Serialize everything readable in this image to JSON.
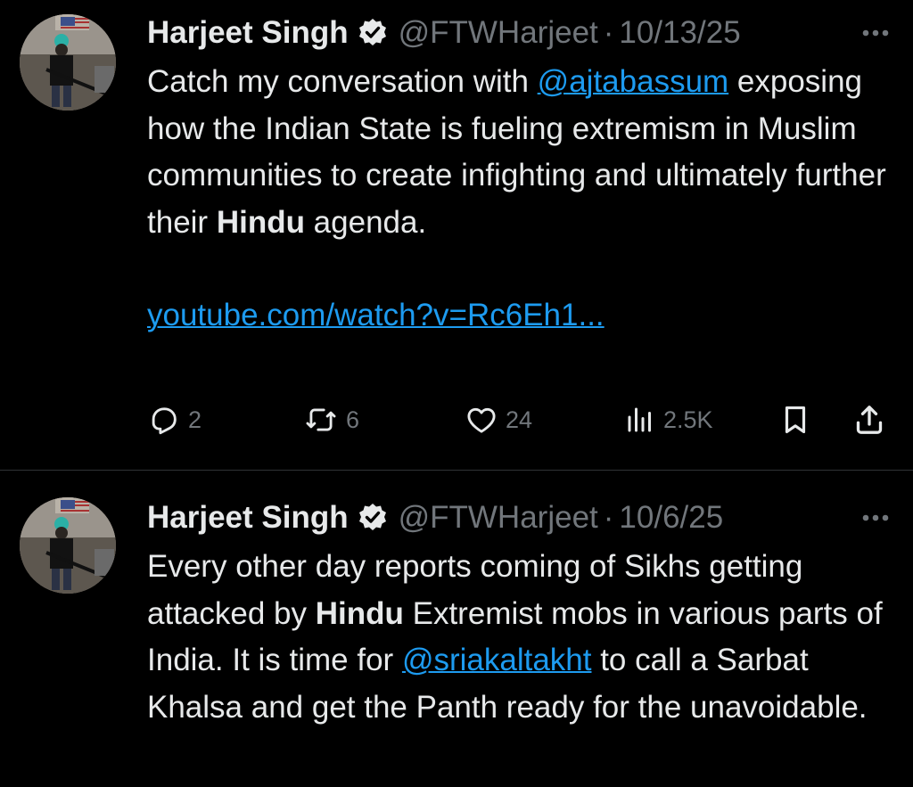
{
  "tweets": [
    {
      "author_name": "Harjeet Singh",
      "handle": "@FTWHarjeet",
      "separator": "·",
      "date": "10/13/25",
      "text_parts": [
        "Catch my conversation with ",
        "@ajtabassum",
        " exposing how the Indian State is fueling extremism in Muslim communities to create infighting and ultimately further their ",
        "Hindu",
        " agenda."
      ],
      "link": "youtube.com/watch?v=Rc6Eh1...",
      "metrics": {
        "replies": "2",
        "reposts": "6",
        "likes": "24",
        "views": "2.5K"
      },
      "icons": {
        "reply": "reply-icon",
        "repost": "repost-icon",
        "like": "like-icon",
        "views": "views-icon",
        "bookmark": "bookmark-icon",
        "share": "share-icon",
        "more": "more-icon",
        "verified": "verified-badge-icon"
      }
    },
    {
      "author_name": "Harjeet Singh",
      "handle": "@FTWHarjeet",
      "separator": "·",
      "date": "10/6/25",
      "text_parts": [
        "Every other day reports coming of Sikhs getting attacked by ",
        "Hindu",
        " Extremist mobs in various parts of India. It is time for ",
        "@sriakaltakht",
        " to call a Sarbat Khalsa and get the Panth ready for the unavoidable."
      ]
    }
  ],
  "colors": {
    "background": "#000000",
    "text": "#e7e9ea",
    "secondary": "#71767b",
    "accent": "#1d9bf0",
    "divider": "#2f3336"
  }
}
